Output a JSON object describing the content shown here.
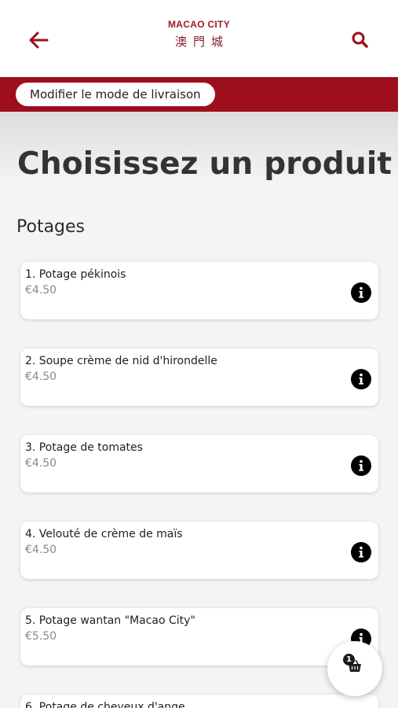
{
  "header": {
    "logo_text": "MACAO CITY",
    "logo_chinese": "澳門城",
    "back_icon": "arrow-left-icon",
    "search_icon": "search-icon"
  },
  "delivery_button_label": "Modifier le mode de livraison",
  "page_title": "Choisissez un produit",
  "section_title": "Potages",
  "products": [
    {
      "name": "1. Potage pékinois",
      "price": "€4.50"
    },
    {
      "name": "2. Soupe crème de nid d'hirondelle",
      "price": "€4.50"
    },
    {
      "name": "3. Potage de tomates",
      "price": "€4.50"
    },
    {
      "name": "4. Velouté de crème de maïs",
      "price": "€4.50"
    },
    {
      "name": "5. Potage wantan \"Macao City\"",
      "price": "€5.50"
    },
    {
      "name": "6. Potage de cheveux d'ange",
      "price": ""
    }
  ],
  "cart": {
    "count": "1",
    "icon": "basket-icon"
  },
  "colors": {
    "brand_red": "#9d0f1d",
    "logo_red": "#9b1b2a",
    "background": "#f4f4f4"
  }
}
